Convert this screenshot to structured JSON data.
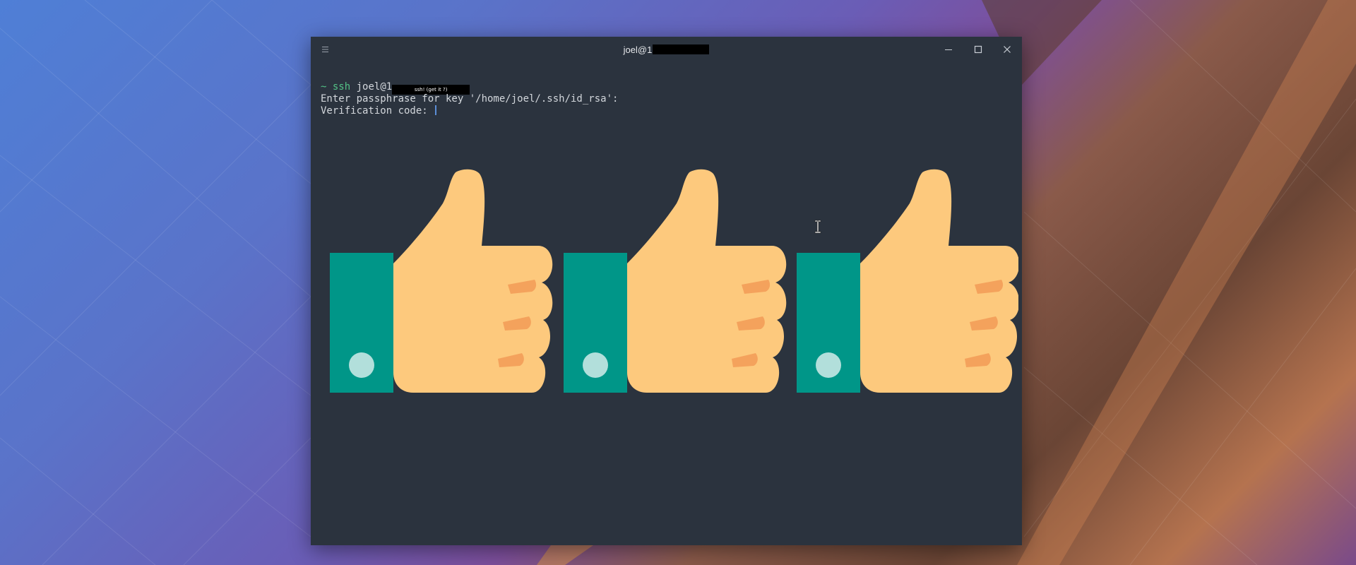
{
  "window": {
    "title_prefix": "joel@1",
    "title_redaction": ""
  },
  "terminal": {
    "prompt_symbol": "~",
    "command": "ssh",
    "host_prefix": "joel@1",
    "redaction_note": "ssh! (get it ?)",
    "passphrase_prompt": "Enter passphrase for key '/home/joel/.ssh/id_rsa':",
    "verification_prompt": "Verification code: "
  },
  "icons": {
    "menu": "hamburger-menu-icon",
    "minimize": "minimize-icon",
    "maximize": "maximize-icon",
    "close": "close-icon",
    "thumbs": "thumbs-up-icon",
    "text_cursor": "ibeam-cursor-icon"
  },
  "colors": {
    "terminal_bg": "#2b333e",
    "prompt": "#53c186",
    "text": "#d3d7dc",
    "cuff": "#009688",
    "cuff_button": "#b2dfdb",
    "hand": "#fdc97d",
    "fingers": "#f4a25c"
  }
}
